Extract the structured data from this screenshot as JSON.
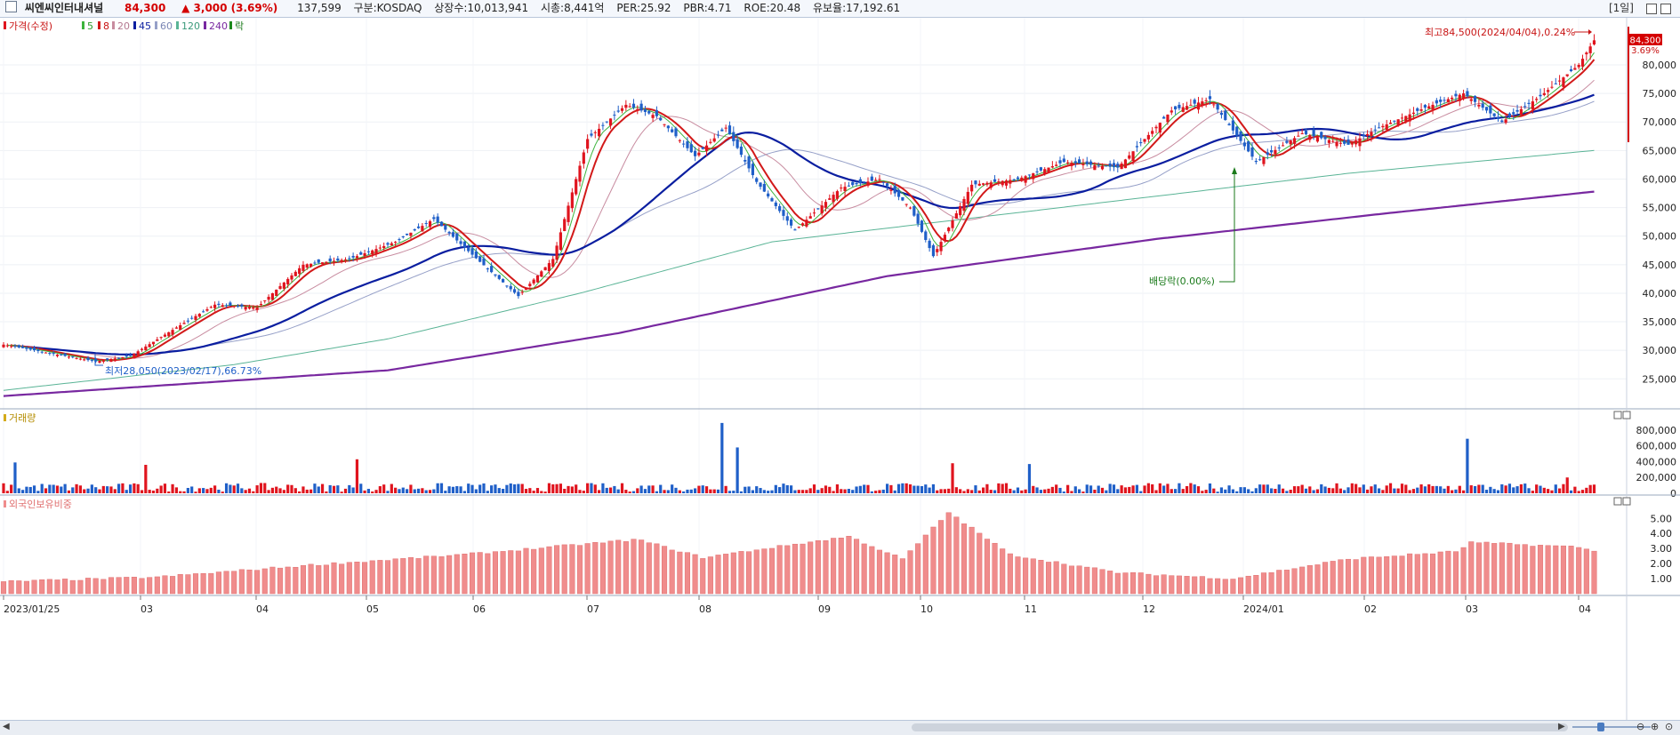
{
  "header": {
    "name": "씨엔씨인터내셔널",
    "price": "84,300",
    "change": "▲ 3,000  (3.69%)",
    "volume": "137,599",
    "market": "구분:KOSDAQ",
    "shares": "상장수:10,013,941",
    "mcap": "시총:8,441억",
    "per": "PER:25.92",
    "pbr": "PBR:4.71",
    "roe": "ROE:20.48",
    "float": "유보율:17,192.61",
    "timeframe": "[1일]"
  },
  "legend": {
    "price": "가격(수정)",
    "ma5": "5",
    "ma8": "8",
    "ma20": "20",
    "ma45": "45",
    "ma60": "60",
    "ma120": "120",
    "ma240": "240",
    "ex": "락",
    "volume": "거래량",
    "foreign": "외국인보유비중"
  },
  "colors": {
    "up": "#e0141e",
    "down": "#1f5fc8",
    "ma5": "#3cb43c",
    "ma8": "#d21919",
    "ma20": "#c88ca0",
    "ma45": "#0a1ea0",
    "ma60": "#96a0c8",
    "ma120": "#5ab496",
    "ma240": "#7828a0",
    "foreign": "#f08c8c"
  },
  "chart_data": {
    "type": "line",
    "x_labels": [
      "2023/01/25",
      "03",
      "04",
      "05",
      "06",
      "07",
      "08",
      "09",
      "10",
      "11",
      "12",
      "2024/01",
      "02",
      "03",
      "04"
    ],
    "price_axis": [
      "80,000",
      "75,000",
      "70,000",
      "65,000",
      "60,000",
      "55,000",
      "50,000",
      "45,000",
      "40,000",
      "35,000",
      "30,000",
      "25,000"
    ],
    "price_ylim": [
      21000,
      87000
    ],
    "price_path": [
      [
        0,
        31000
      ],
      [
        12,
        29500
      ],
      [
        24,
        28050
      ],
      [
        33,
        29000
      ],
      [
        45,
        34000
      ],
      [
        55,
        38000
      ],
      [
        66,
        37500
      ],
      [
        78,
        45000
      ],
      [
        90,
        46000
      ],
      [
        102,
        49000
      ],
      [
        112,
        53000
      ],
      [
        124,
        45500
      ],
      [
        134,
        39500
      ],
      [
        143,
        46000
      ],
      [
        152,
        67000
      ],
      [
        162,
        73000
      ],
      [
        170,
        71000
      ],
      [
        180,
        64000
      ],
      [
        188,
        69000
      ],
      [
        196,
        59500
      ],
      [
        206,
        51000
      ],
      [
        218,
        58500
      ],
      [
        228,
        60000
      ],
      [
        236,
        55000
      ],
      [
        242,
        46500
      ],
      [
        252,
        59000
      ],
      [
        264,
        60000
      ],
      [
        276,
        63000
      ],
      [
        290,
        62000
      ],
      [
        304,
        72000
      ],
      [
        314,
        74000
      ],
      [
        326,
        63000
      ],
      [
        338,
        68000
      ],
      [
        350,
        66000
      ],
      [
        358,
        69000
      ],
      [
        370,
        72500
      ],
      [
        380,
        75000
      ],
      [
        390,
        70000
      ],
      [
        400,
        74500
      ],
      [
        410,
        80000
      ],
      [
        414,
        84300
      ]
    ],
    "ma_trends": {
      "ma120": [
        [
          0,
          23000
        ],
        [
          60,
          27500
        ],
        [
          100,
          32000
        ],
        [
          150,
          40000
        ],
        [
          200,
          49000
        ],
        [
          250,
          53000
        ],
        [
          300,
          57000
        ],
        [
          350,
          61000
        ],
        [
          414,
          65000
        ]
      ],
      "ma240": [
        [
          0,
          22000
        ],
        [
          100,
          26500
        ],
        [
          160,
          33000
        ],
        [
          230,
          43000
        ],
        [
          300,
          49500
        ],
        [
          360,
          54000
        ],
        [
          414,
          57800
        ]
      ]
    },
    "annotations": {
      "high": "최고84,500(2024/04/04),0.24%",
      "low": "최저28,050(2023/02/17),66.73%",
      "dividend": "배당락(0.00%)",
      "last_price": "84,300",
      "last_change": "3.69%"
    },
    "volume_axis": [
      "800,000",
      "600,000",
      "400,000",
      "200,000",
      "0"
    ],
    "volume_ylim": [
      0,
      900000
    ],
    "volume_peaks": [
      [
        3,
        390000
      ],
      [
        37,
        360000
      ],
      [
        92,
        430000
      ],
      [
        187,
        890000
      ],
      [
        191,
        580000
      ],
      [
        247,
        380000
      ],
      [
        267,
        370000
      ],
      [
        381,
        690000
      ],
      [
        407,
        200000
      ]
    ],
    "foreign_axis": [
      "5.00",
      "4.00",
      "3.00",
      "2.00",
      "1.00"
    ],
    "foreign_ylim": [
      0,
      5.9
    ],
    "foreign_path": [
      [
        0,
        0.8
      ],
      [
        40,
        1.1
      ],
      [
        80,
        1.9
      ],
      [
        120,
        2.6
      ],
      [
        165,
        3.6
      ],
      [
        182,
        2.4
      ],
      [
        220,
        3.8
      ],
      [
        234,
        2.3
      ],
      [
        246,
        5.4
      ],
      [
        262,
        2.6
      ],
      [
        290,
        1.4
      ],
      [
        320,
        1.0
      ],
      [
        350,
        2.3
      ],
      [
        378,
        2.8
      ],
      [
        382,
        3.4
      ],
      [
        410,
        3.1
      ],
      [
        414,
        2.8
      ]
    ]
  }
}
